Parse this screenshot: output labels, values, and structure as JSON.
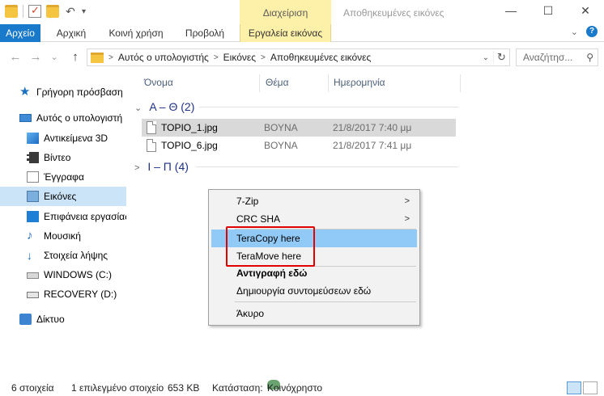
{
  "titlebar": {
    "manage_tab": "Διαχείριση",
    "window_title": "Αποθηκευμένες εικόνες",
    "minimize": "—",
    "maximize": "☐",
    "close": "✕"
  },
  "ribbon": {
    "tabs": [
      "Αρχείο",
      "Αρχική",
      "Κοινή χρήση",
      "Προβολή",
      "Εργαλεία εικόνας"
    ],
    "expand": "⌄",
    "help": "?"
  },
  "address": {
    "back": "←",
    "forward": "→",
    "recent": "⌄",
    "up": "↑",
    "segments": [
      "Αυτός ο υπολογιστής",
      "Εικόνες",
      "Αποθηκευμένες εικόνες"
    ],
    "separator": ">",
    "search_placeholder": "Αναζήτησ...",
    "search_icon": "⚲"
  },
  "navpane": {
    "items": [
      {
        "label": "Γρήγορη πρόσβαση",
        "icon": "star-icon"
      },
      {
        "label": "Αυτός ο υπολογιστή",
        "icon": "computer-icon"
      },
      {
        "label": "Αντικείμενα 3D",
        "icon": "objects-3d-icon"
      },
      {
        "label": "Βίντεο",
        "icon": "video-icon"
      },
      {
        "label": "Έγγραφα",
        "icon": "documents-icon"
      },
      {
        "label": "Εικόνες",
        "icon": "pictures-icon"
      },
      {
        "label": "Επιφάνεια εργασίας",
        "icon": "desktop-icon"
      },
      {
        "label": "Μουσική",
        "icon": "music-icon"
      },
      {
        "label": "Στοιχεία λήψης",
        "icon": "downloads-icon"
      },
      {
        "label": "WINDOWS (C:)",
        "icon": "drive-icon"
      },
      {
        "label": "RECOVERY (D:)",
        "icon": "drive-icon"
      },
      {
        "label": "Δίκτυο",
        "icon": "network-icon"
      }
    ],
    "selected": "Εικόνες"
  },
  "columns": [
    "Όνομα",
    "Θέμα",
    "Ημερομηνία"
  ],
  "groups": [
    {
      "label": "Α – Θ (2)",
      "chevron": "⌄"
    },
    {
      "label": "Ι – Π (4)",
      "chevron": ">"
    }
  ],
  "files": [
    {
      "name": "TOPIO_1.jpg",
      "subject": "ΒΟΥΝΑ",
      "date": "21/8/2017 7:40 μμ",
      "selected": true
    },
    {
      "name": "TOPIO_6.jpg",
      "subject": "ΒΟΥΝΑ",
      "date": "21/8/2017 7:41 μμ",
      "selected": false
    }
  ],
  "context_menu": {
    "items": [
      {
        "label": "7-Zip",
        "submenu": true
      },
      {
        "label": "CRC SHA",
        "submenu": true
      },
      {
        "label": "TeraCopy here",
        "highlighted": true
      },
      {
        "label": "TeraMove here"
      },
      {
        "label": "Αντιγραφή εδώ",
        "bold": true
      },
      {
        "label": "Δημιουργία συντομεύσεων εδώ"
      },
      {
        "label": "Άκυρο"
      }
    ],
    "submenu_arrow": ">"
  },
  "status": {
    "count": "6 στοιχεία",
    "selection": "1 επιλεγμένο στοιχείο",
    "size": "653 KB",
    "state_label": "Κατάσταση:",
    "state_value": "Κοινόχρηστο"
  }
}
